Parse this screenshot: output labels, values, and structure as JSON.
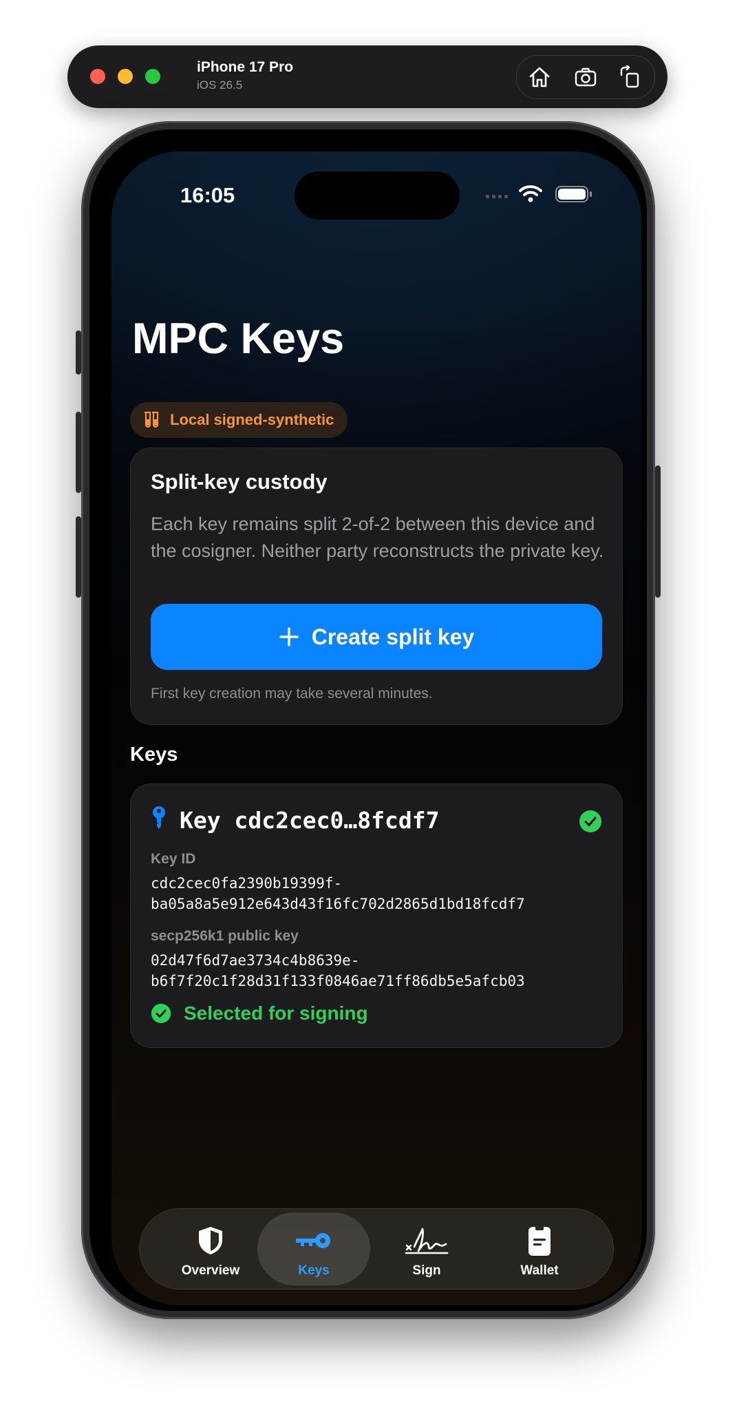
{
  "simulator": {
    "device_name": "iPhone 17 Pro",
    "os_version": "iOS 26.5",
    "tools": [
      "home-icon",
      "screenshot-icon",
      "rotate-icon"
    ]
  },
  "status_bar": {
    "time": "16:05"
  },
  "page": {
    "title": "MPC Keys",
    "mode_badge": "Local signed-synthetic"
  },
  "custody_card": {
    "title": "Split-key custody",
    "description": "Each key remains split 2-of-2 between this device and the cosigner. Neither party reconstructs the private key.",
    "button_label": "Create split key",
    "footnote": "First key creation may take several minutes."
  },
  "keys_section": {
    "title": "Keys",
    "items": [
      {
        "name": "Key cdc2cec0…8fcdf7",
        "key_id_label": "Key ID",
        "key_id": "cdc2cec0fa2390b19399f-\nba05a8a5e912e643d43f16fc702d2865d1bd18fcdf7",
        "pubkey_label": "secp256k1 public key",
        "pubkey": "02d47f6d7ae3734c4b8639e-\nb6f7f20c1f28d31f133f0846ae71ff86db5e5afcb03",
        "status": "Selected for signing"
      }
    ]
  },
  "tab_bar": {
    "tabs": [
      {
        "label": "Overview",
        "icon": "shield-icon"
      },
      {
        "label": "Keys",
        "icon": "key-icon",
        "selected": true
      },
      {
        "label": "Sign",
        "icon": "signature-icon"
      },
      {
        "label": "Wallet",
        "icon": "wallet-icon"
      }
    ]
  },
  "colors": {
    "accent": "#0a84ff",
    "success": "#30d158",
    "warning": "#f5953f"
  }
}
